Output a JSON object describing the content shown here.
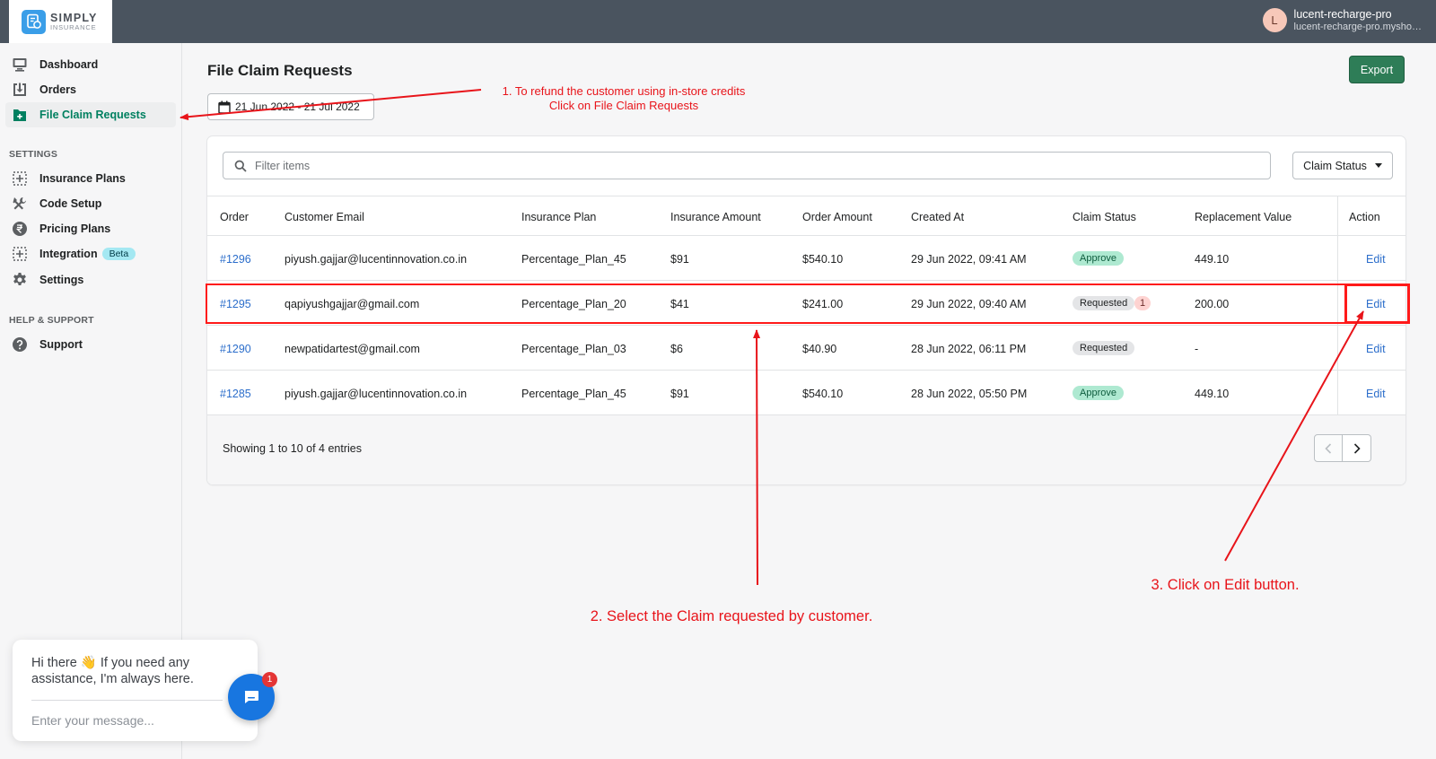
{
  "app": {
    "logo_line1": "SIMPLY",
    "logo_line2": "INSURANCE",
    "user_initial": "L",
    "user_name": "lucent-recharge-pro",
    "user_domain": "lucent-recharge-pro.mysho…"
  },
  "sidebar": {
    "items": [
      {
        "label": "Dashboard",
        "icon": "monitor-icon"
      },
      {
        "label": "Orders",
        "icon": "download-box-icon"
      },
      {
        "label": "File Claim Requests",
        "icon": "file-plus-icon",
        "active": true
      }
    ],
    "settings_title": "SETTINGS",
    "settings_items": [
      {
        "label": "Insurance Plans",
        "icon": "dotted-plus-icon"
      },
      {
        "label": "Code Setup",
        "icon": "tools-icon"
      },
      {
        "label": "Pricing Plans",
        "icon": "rupee-icon"
      },
      {
        "label": "Integration",
        "icon": "dotted-plus-icon",
        "badge": "Beta"
      },
      {
        "label": "Settings",
        "icon": "gear-icon"
      }
    ],
    "help_title": "HELP & SUPPORT",
    "help_items": [
      {
        "label": "Support",
        "icon": "question-icon"
      }
    ]
  },
  "main": {
    "title": "File Claim Requests",
    "export_label": "Export",
    "date_range": "21 Jun 2022 - 21 Jul 2022",
    "filter_placeholder": "Filter items",
    "claim_status_filter": "Claim Status",
    "columns": [
      "Order",
      "Customer Email",
      "Insurance Plan",
      "Insurance Amount",
      "Order Amount",
      "Created At",
      "Claim Status",
      "Replacement Value",
      "Action"
    ],
    "rows": [
      {
        "order": "#1296",
        "email": "piyush.gajjar@lucentinnovation.co.in",
        "plan": "Percentage_Plan_45",
        "insurance_amount": "$91",
        "order_amount": "$540.10",
        "created_at": "29 Jun 2022, 09:41 AM",
        "status": "Approve",
        "status_count": "",
        "replacement": "449.10",
        "action": "Edit"
      },
      {
        "order": "#1295",
        "email": "qapiyushgajjar@gmail.com",
        "plan": "Percentage_Plan_20",
        "insurance_amount": "$41",
        "order_amount": "$241.00",
        "created_at": "29 Jun 2022, 09:40 AM",
        "status": "Requested",
        "status_count": "1",
        "replacement": "200.00",
        "action": "Edit"
      },
      {
        "order": "#1290",
        "email": "newpatidartest@gmail.com",
        "plan": "Percentage_Plan_03",
        "insurance_amount": "$6",
        "order_amount": "$40.90",
        "created_at": "28 Jun 2022, 06:11 PM",
        "status": "Requested",
        "status_count": "",
        "replacement": "-",
        "action": "Edit"
      },
      {
        "order": "#1285",
        "email": "piyush.gajjar@lucentinnovation.co.in",
        "plan": "Percentage_Plan_45",
        "insurance_amount": "$91",
        "order_amount": "$540.10",
        "created_at": "28 Jun 2022, 05:50 PM",
        "status": "Approve",
        "status_count": "",
        "replacement": "449.10",
        "action": "Edit"
      }
    ],
    "showing_text": "Showing 1 to 10 of 4 entries"
  },
  "annotations": {
    "step1_line1": "1. To refund the customer using in-store credits",
    "step1_line2": "Click on File Claim Requests",
    "step2": "2. Select the Claim requested by customer.",
    "step3": "3. Click on Edit button.",
    "color": "#e8141a"
  },
  "chat": {
    "greeting": "Hi there 👋 If you need any assistance, I'm always here.",
    "input_placeholder": "Enter your message...",
    "unread_count": "1"
  },
  "colors": {
    "topbar": "#4a545f",
    "accent_green": "#008060",
    "export_button": "#2e7d57",
    "link_blue": "#2c6ecb",
    "chat_blue": "#1876e0"
  }
}
